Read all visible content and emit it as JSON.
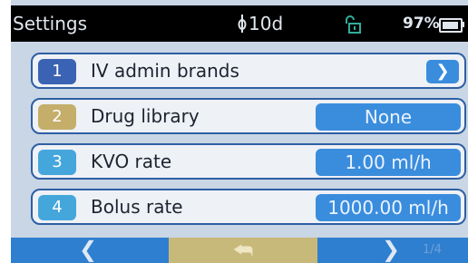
{
  "status_bar": {
    "title": "Settings",
    "infusion_duration": "10d",
    "lock_icon": "unlocked-padlock-icon",
    "battery_percent_label": "97%",
    "battery_fill_fraction": 0.97
  },
  "colors": {
    "header_bg": "#000000",
    "screen_bg": "#c9d6e5",
    "row_border": "#2e5fa3",
    "value_bg": "#3a8ddd",
    "nav_bg": "#2f7fd0",
    "nav_mid_bg": "#c7b97a",
    "selected_index_bg": "#c4ae6a",
    "index_bg": "#3b63b3",
    "index_bg_alt": "#45a6dc"
  },
  "rows": [
    {
      "index": "1",
      "label": "IV admin brands",
      "value": null,
      "action_icon": "chevron-right-icon"
    },
    {
      "index": "2",
      "label": "Drug library",
      "value": "None"
    },
    {
      "index": "3",
      "label": "KVO rate",
      "value": "1.00 ml/h"
    },
    {
      "index": "4",
      "label": "Bolus rate",
      "value": "1000.00 ml/h"
    }
  ],
  "nav": {
    "back_icon": "chevron-left-icon",
    "return_icon": "return-arrow-icon",
    "next_icon": "chevron-right-icon",
    "page_indicator": "1/4"
  }
}
